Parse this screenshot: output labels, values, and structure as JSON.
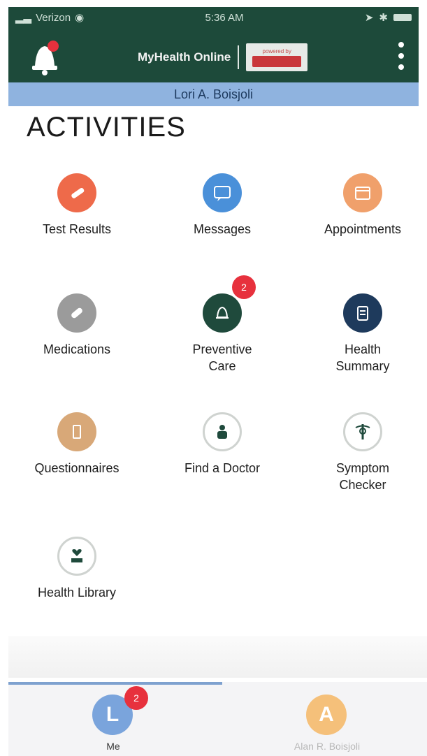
{
  "status": {
    "carrier": "Verizon",
    "time": "5:36 AM"
  },
  "header": {
    "brand": "MyHealth Online",
    "powered_by": "powered by"
  },
  "patient": {
    "name": "Lori A. Boisjoli"
  },
  "page": {
    "title": "ACTIVITIES"
  },
  "activities": [
    {
      "label": "Test Results",
      "color": "#ee6a4a",
      "icon": "test-tube-icon"
    },
    {
      "label": "Messages",
      "color": "#4a90d9",
      "icon": "message-bubble-icon"
    },
    {
      "label": "Appointments",
      "color": "#f0a06b",
      "icon": "calendar-icon"
    },
    {
      "label": "Medications",
      "color": "#9b9b9b",
      "icon": "pill-icon"
    },
    {
      "label": "Preventive Care",
      "color": "#1f4a3c",
      "icon": "bell-icon",
      "badge": "2"
    },
    {
      "label": "Health Summary",
      "color": "#1e3a5c",
      "icon": "clipboard-icon"
    },
    {
      "label": "Questionnaires",
      "color": "#d8a878",
      "icon": "questionnaire-icon"
    },
    {
      "label": "Find a Doctor",
      "color": "#ffffff",
      "icon": "doctor-icon"
    },
    {
      "label": "Symptom Checker",
      "color": "#ffffff",
      "icon": "caduceus-icon"
    },
    {
      "label": "Health Library",
      "color": "#ffffff",
      "icon": "heart-book-icon"
    }
  ],
  "tabs": [
    {
      "label": "Me",
      "initial": "L",
      "color": "#7aa4dc",
      "badge": "2"
    },
    {
      "label": "Alan R. Boisjoli",
      "initial": "A",
      "color": "#f5c07a"
    }
  ]
}
